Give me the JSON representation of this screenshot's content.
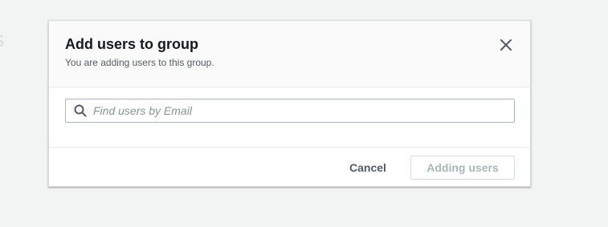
{
  "background": {
    "heading_fragment": "ils"
  },
  "modal": {
    "title": "Add users to group",
    "subtitle": "You are adding users to this group.",
    "close_icon": "close-icon",
    "search": {
      "icon": "search-icon",
      "placeholder": "Find users by Email",
      "value": ""
    },
    "footer": {
      "cancel_label": "Cancel",
      "primary_label": "Adding users",
      "primary_disabled": true
    }
  },
  "colors": {
    "page_background": "#f2f3f3",
    "modal_background": "#ffffff",
    "header_background": "#fafafa",
    "title_text": "#16191f",
    "secondary_text": "#545b64",
    "disabled_text": "#aab7b8",
    "placeholder_text": "#879596"
  }
}
